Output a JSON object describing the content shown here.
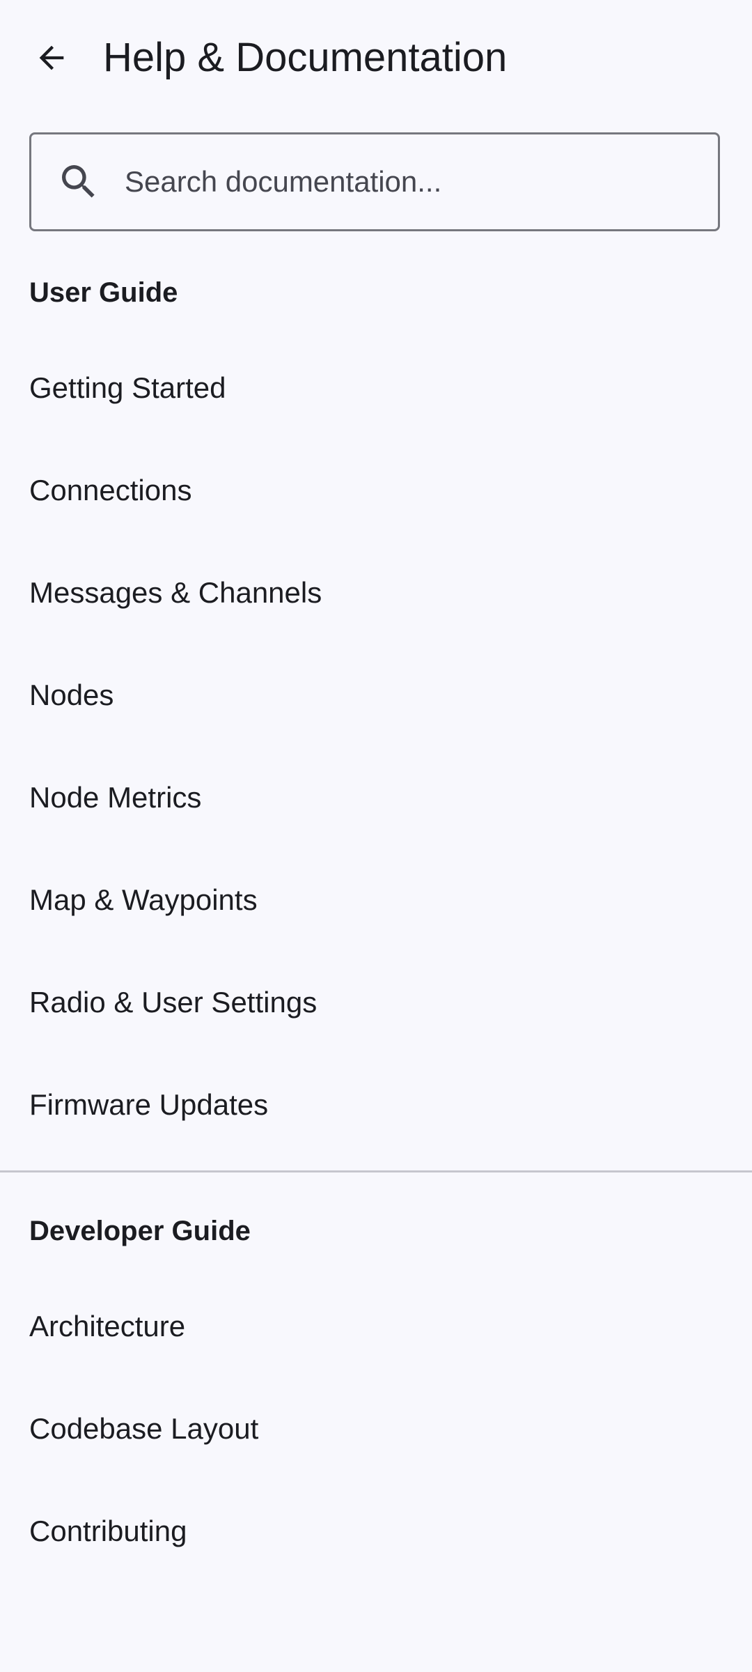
{
  "header": {
    "title": "Help & Documentation",
    "back_icon": "arrow-back-icon"
  },
  "search": {
    "placeholder": "Search documentation...",
    "value": "",
    "icon": "search-icon"
  },
  "user_guide": {
    "title": "User Guide",
    "items": [
      {
        "label": "Getting Started"
      },
      {
        "label": "Connections"
      },
      {
        "label": "Messages & Channels"
      },
      {
        "label": "Nodes"
      },
      {
        "label": "Node Metrics"
      },
      {
        "label": "Map & Waypoints"
      },
      {
        "label": "Radio & User Settings"
      },
      {
        "label": "Firmware Updates"
      }
    ]
  },
  "developer_guide": {
    "title": "Developer Guide",
    "items": [
      {
        "label": "Architecture"
      },
      {
        "label": "Codebase Layout"
      },
      {
        "label": "Contributing"
      }
    ]
  },
  "colors": {
    "background": "#f8f8fd",
    "text": "#1b1c21",
    "outline": "#76777e",
    "divider": "#c6c6ce"
  }
}
